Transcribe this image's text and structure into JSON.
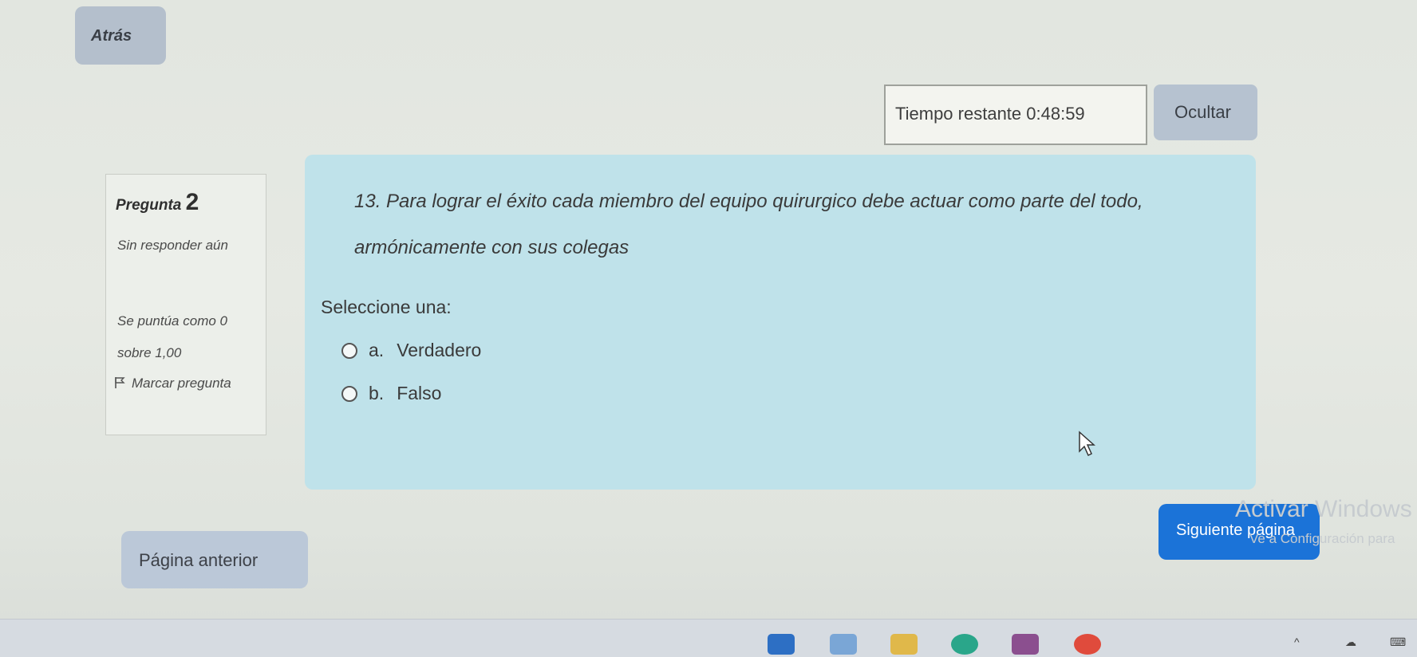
{
  "nav": {
    "back_label": "Atrás"
  },
  "timer": {
    "text": "Tiempo restante 0:48:59",
    "hide_label": "Ocultar"
  },
  "question_info": {
    "title": "Pregunta",
    "number": "2",
    "status": "Sin responder aún",
    "score": "Se puntúa como 0 sobre 1,00",
    "flag_label": "Marcar pregunta"
  },
  "question": {
    "text": "13. Para lograr el éxito cada miembro del equipo quirurgico debe actuar como parte del todo, armónicamente con sus colegas",
    "prompt": "Seleccione una:",
    "options": [
      {
        "letter": "a.",
        "label": "Verdadero"
      },
      {
        "letter": "b.",
        "label": "Falso"
      }
    ]
  },
  "pagination": {
    "prev_label": "Página anterior",
    "next_label": "Siguiente página"
  },
  "watermark": {
    "title": "Activar Windows",
    "subtitle": "Ve a Configuración para"
  },
  "colors": {
    "question_bg": "#bfe2ea",
    "next_button": "#1b73d8",
    "secondary_button": "#b6c2d0"
  },
  "icons": {
    "flag": "flag-icon",
    "cursor": "mouse-pointer-icon"
  }
}
